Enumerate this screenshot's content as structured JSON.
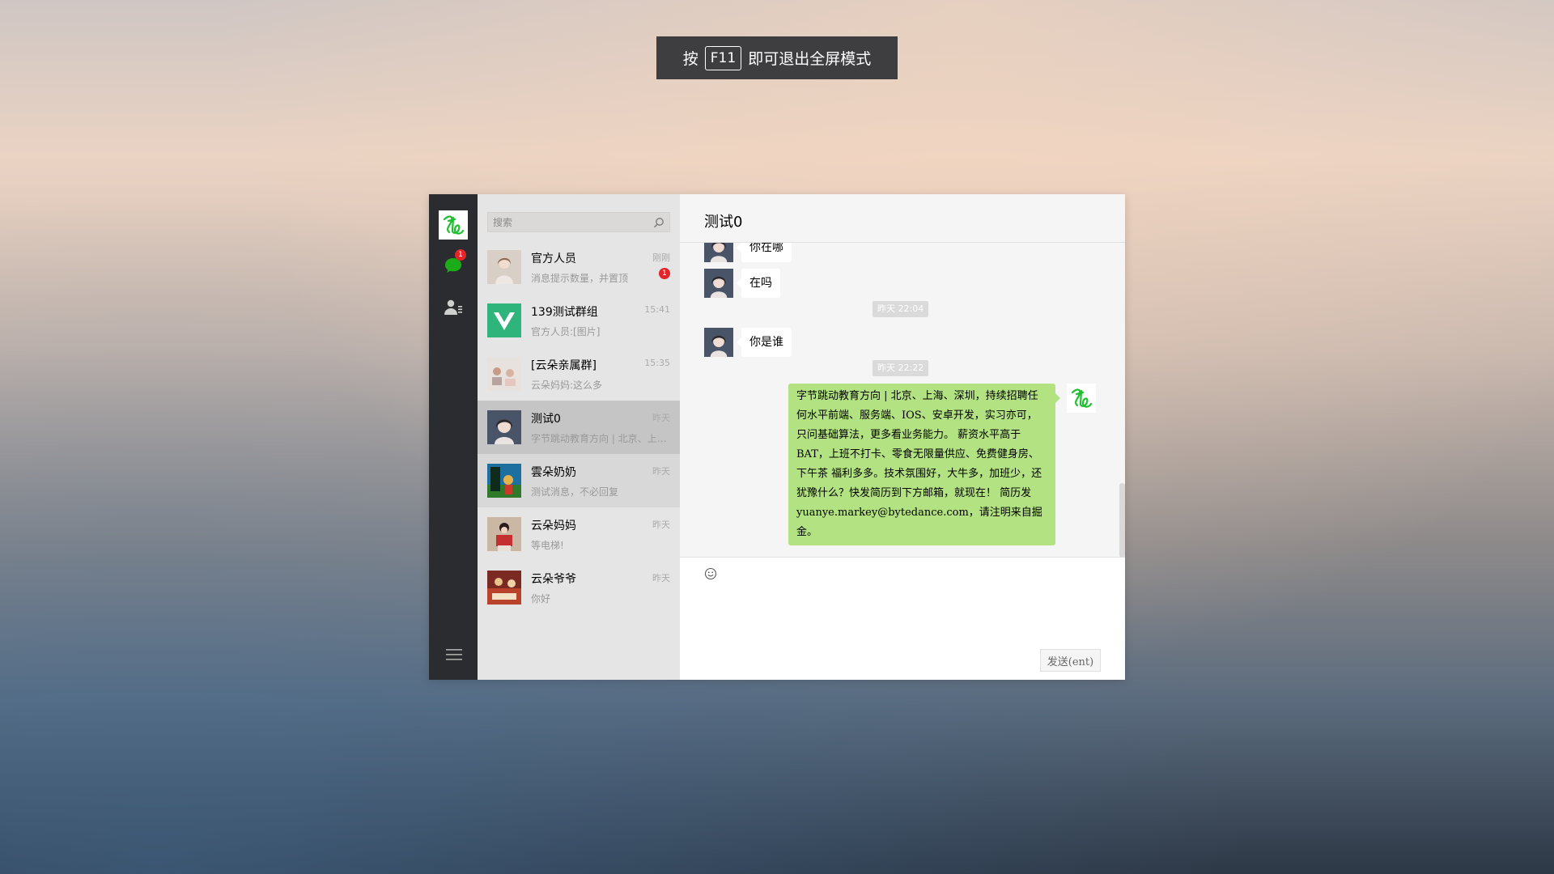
{
  "toast": {
    "prefix": "按",
    "key": "F11",
    "suffix": "即可退出全屏模式"
  },
  "rail": {
    "chat_badge": "1"
  },
  "search": {
    "placeholder": "搜索"
  },
  "chats": [
    {
      "name": "官方人员",
      "preview": "消息提示数量，并置顶",
      "time": "刚刚",
      "unread": "1"
    },
    {
      "name": "139测试群组",
      "preview": "官方人员:[图片]",
      "time": "15:41"
    },
    {
      "name": "[云朵亲属群]",
      "preview": "云朵妈妈:这么多",
      "time": "15:35"
    },
    {
      "name": "测试0",
      "preview": "字节跳动教育方向 | 北京、上海、深圳，持续招聘",
      "time": "昨天"
    },
    {
      "name": "雲朵奶奶",
      "preview": "测试消息，不必回复",
      "time": "昨天"
    },
    {
      "name": "云朵妈妈",
      "preview": "等电梯!",
      "time": "昨天"
    },
    {
      "name": "云朵爷爷",
      "preview": "你好",
      "time": "昨天"
    }
  ],
  "conversation": {
    "title": "测试0",
    "messages": [
      {
        "text": "你在哪"
      },
      {
        "text": "在吗"
      },
      {
        "stamp": "昨天 22:04"
      },
      {
        "text": "你是谁"
      },
      {
        "stamp": "昨天 22:22"
      }
    ],
    "sent_text": "字节跳动教育方向 | 北京、上海、深圳，持续招聘任何水平前端、服务端、IOS、安卓开发，实习亦可，只问基础算法，更多看业务能力。 薪资水平高于 BAT，上班不打卡、零食无限量供应、免费健身房、下午茶 福利多多。技术氛围好，大牛多，加班少，还犹豫什么？快发简历到下方邮箱，就现在！ 简历发 yuanye.markey@bytedance.com，请注明来自掘金。"
  },
  "composer": {
    "send_label": "发送(ent)"
  },
  "colors": {
    "rail": "#2b2c2f",
    "list": "#e6e5e5",
    "sent_bubble": "#b2e281",
    "badge": "#e2262a",
    "brand_green": "#1aad19"
  }
}
